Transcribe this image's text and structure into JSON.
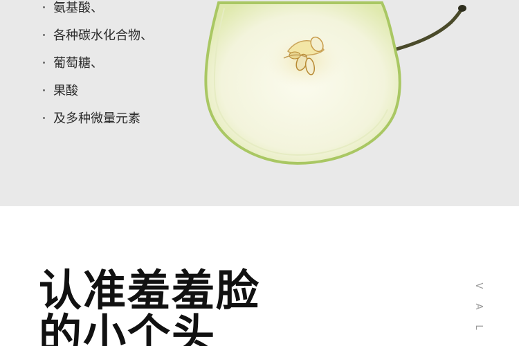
{
  "nutrients": {
    "items": [
      "氨基酸、",
      "各种碳水化合物、",
      "葡萄糖、",
      "果酸",
      "及多种微量元素"
    ]
  },
  "headline": {
    "line1": "认准羞羞脸",
    "line2": "的小个头"
  },
  "vertical_label": {
    "letters": [
      "V",
      "A",
      "L"
    ]
  },
  "colors": {
    "top_background": "#e9e9e9",
    "apple_flesh": "#f7f7e6",
    "apple_skin": "#b9d27a"
  }
}
